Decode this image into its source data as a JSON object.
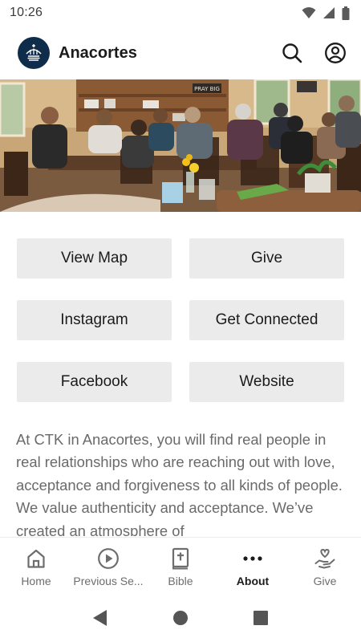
{
  "status_bar": {
    "time": "10:26",
    "icons": [
      "wifi-icon",
      "signal-icon",
      "battery-icon"
    ]
  },
  "header": {
    "title": "Anacortes",
    "logo_icon": "church-logo-icon",
    "actions": [
      "search-icon",
      "account-icon"
    ]
  },
  "hero": {
    "sign_text": "PRAY BIG"
  },
  "buttons": [
    {
      "label": "View Map"
    },
    {
      "label": "Give"
    },
    {
      "label": "Instagram"
    },
    {
      "label": "Get Connected"
    },
    {
      "label": "Facebook"
    },
    {
      "label": "Website"
    }
  ],
  "description": {
    "text": "At CTK in Anacortes, you will find real people in real relationships who are reaching out with love, acceptance and forgiveness to all kinds of people. We value authenticity and acceptance. We’ve created an atmosphere of"
  },
  "bottom_nav": {
    "active": "About",
    "items": [
      {
        "label": "Home",
        "icon": "home-icon"
      },
      {
        "label": "Previous Se...",
        "icon": "play-circle-icon"
      },
      {
        "label": "Bible",
        "icon": "bible-icon"
      },
      {
        "label": "About",
        "icon": "more-dots-icon"
      },
      {
        "label": "Give",
        "icon": "give-hand-heart-icon"
      }
    ]
  },
  "system_nav": [
    "back-icon",
    "home-circle-icon",
    "recents-square-icon"
  ],
  "colors": {
    "logo_bg": "#0f2d4a",
    "button_bg": "#ebebeb",
    "body_text": "#6a6a6a",
    "nav_inactive": "#6d6d6d",
    "nav_active": "#1b1b1b"
  }
}
